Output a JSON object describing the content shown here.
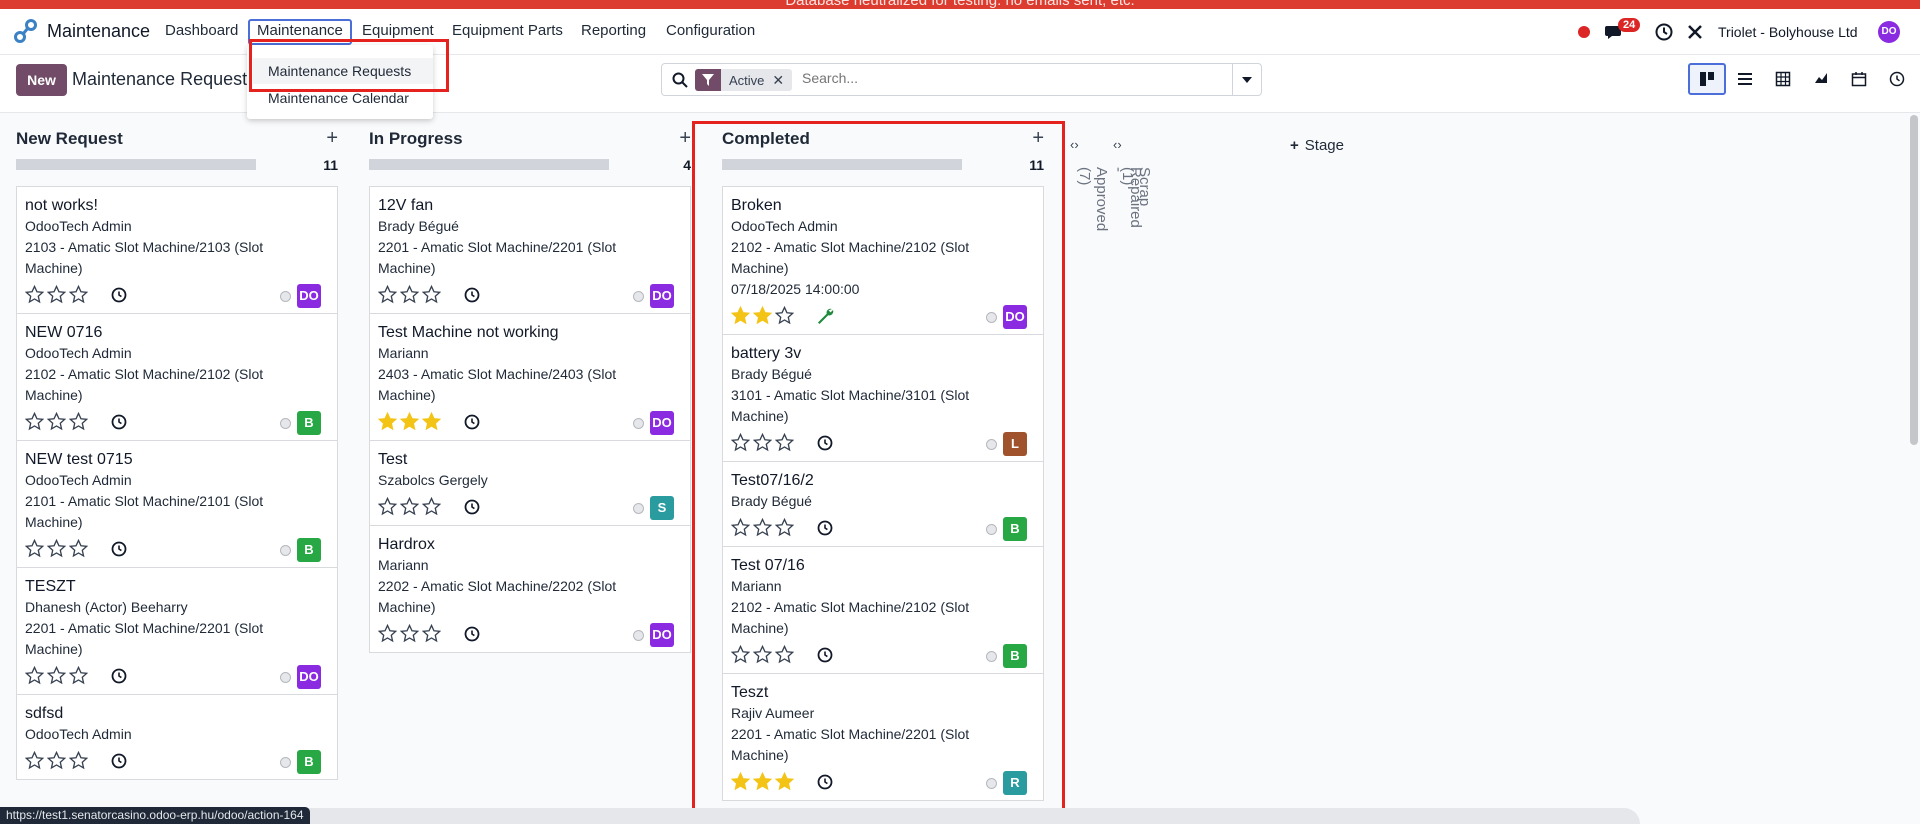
{
  "banner": {
    "text": "Database neutralized for testing: no emails sent, etc."
  },
  "nav": {
    "app_name": "Maintenance",
    "menu": [
      "Dashboard",
      "Maintenance",
      "Equipment",
      "Equipment Parts",
      "Reporting",
      "Configuration"
    ],
    "active_menu": "Maintenance",
    "message_count": "24",
    "company": "Triolet - Bolyhouse Ltd",
    "user_avatar": "DO"
  },
  "control": {
    "new_label": "New",
    "breadcrumb": "Maintenance Requests",
    "facet": "Active",
    "search_placeholder": "Search..."
  },
  "dropdown": {
    "items": [
      "Maintenance Requests",
      "Maintenance Calendar"
    ],
    "highlighted": "Maintenance Requests"
  },
  "kanban": {
    "columns": [
      {
        "title": "New Request",
        "count": "11",
        "cards": [
          {
            "title": "not works!",
            "lines": [
              "OdooTech Admin",
              "2103 - Amatic Slot Machine/2103 (Slot",
              "Machine)"
            ],
            "stars": 0,
            "avatar": "DO",
            "avatar_color": "#8a2be2"
          },
          {
            "title": "NEW 0716",
            "lines": [
              "OdooTech Admin",
              "2102 - Amatic Slot Machine/2102 (Slot",
              "Machine)"
            ],
            "stars": 0,
            "avatar": "B",
            "avatar_color": "#28a745"
          },
          {
            "title": "NEW test 0715",
            "lines": [
              "OdooTech Admin",
              "2101 - Amatic Slot Machine/2101 (Slot",
              "Machine)"
            ],
            "stars": 0,
            "avatar": "B",
            "avatar_color": "#28a745"
          },
          {
            "title": "TESZT",
            "lines": [
              "Dhanesh (Actor) Beeharry",
              "2201 - Amatic Slot Machine/2201 (Slot",
              "Machine)"
            ],
            "stars": 0,
            "avatar": "DO",
            "avatar_color": "#8a2be2"
          },
          {
            "title": "sdfsd",
            "lines": [
              "OdooTech Admin"
            ],
            "stars": 0,
            "avatar": "B",
            "avatar_color": "#28a745"
          }
        ]
      },
      {
        "title": "In Progress",
        "count": "4",
        "cards": [
          {
            "title": "12V fan",
            "lines": [
              "Brady Bégué",
              "2201 - Amatic Slot Machine/2201 (Slot",
              "Machine)"
            ],
            "stars": 0,
            "avatar": "DO",
            "avatar_color": "#8a2be2"
          },
          {
            "title": "Test Machine not working",
            "lines": [
              "Mariann",
              "2403 - Amatic Slot Machine/2403 (Slot",
              "Machine)"
            ],
            "stars": 3,
            "avatar": "DO",
            "avatar_color": "#8a2be2"
          },
          {
            "title": "Test",
            "lines": [
              "Szabolcs Gergely"
            ],
            "stars": 0,
            "avatar": "S",
            "avatar_color": "#2a9ca0"
          },
          {
            "title": "Hardrox",
            "lines": [
              "Mariann",
              "2202 - Amatic Slot Machine/2202 (Slot",
              "Machine)"
            ],
            "stars": 0,
            "avatar": "DO",
            "avatar_color": "#8a2be2"
          }
        ]
      },
      {
        "title": "Completed",
        "count": "11",
        "cards": [
          {
            "title": "Broken",
            "lines": [
              "OdooTech Admin",
              "2102 - Amatic Slot Machine/2102 (Slot",
              "Machine)",
              "07/18/2025 14:00:00"
            ],
            "stars": 2,
            "wrench": true,
            "avatar": "DO",
            "avatar_color": "#8a2be2"
          },
          {
            "title": "battery 3v",
            "lines": [
              "Brady Bégué",
              "3101 - Amatic Slot Machine/3101 (Slot",
              "Machine)"
            ],
            "stars": 0,
            "avatar": "L",
            "avatar_color": "#a0522d"
          },
          {
            "title": "Test07/16/2",
            "lines": [
              "Brady Bégué"
            ],
            "stars": 0,
            "avatar": "B",
            "avatar_color": "#28a745"
          },
          {
            "title": "Test 07/16",
            "lines": [
              "Mariann",
              "2102 - Amatic Slot Machine/2102 (Slot",
              "Machine)"
            ],
            "stars": 0,
            "avatar": "B",
            "avatar_color": "#28a745"
          },
          {
            "title": "Teszt",
            "lines": [
              "Rajiv Aumeer",
              "2201 - Amatic Slot Machine/2201 (Slot",
              "Machine)"
            ],
            "stars": 3,
            "avatar": "R",
            "avatar_color": "#2a9ca0"
          }
        ]
      }
    ],
    "folded": [
      "Repaired - Approved (7)",
      "Scrap (1)"
    ],
    "add_stage_label": "Stage"
  },
  "status_url": "https://test1.senatorcasino.odoo-erp.hu/odoo/action-164",
  "colors": {
    "brand": "#714b67",
    "highlight": "#e5221d",
    "accent": "#4b6ed8",
    "star": "#f3c316"
  }
}
